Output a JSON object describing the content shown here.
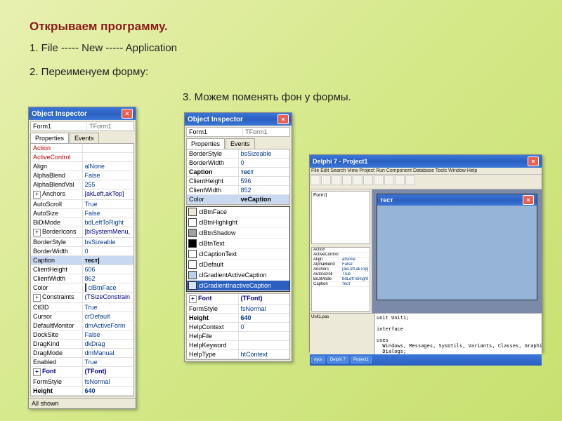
{
  "heading": "Открываем программу.",
  "steps": {
    "s1": "1.   File -----  New -----  Application",
    "s2": "2.   Переименуем форму:",
    "s3": "3.  Можем поменять фон у формы."
  },
  "inspector": {
    "title": "Object Inspector",
    "combo_name": "Form1",
    "combo_type": "TForm1",
    "tab_props": "Properties",
    "tab_events": "Events",
    "footer": "All shown"
  },
  "panel1_rows": [
    {
      "k": "Action",
      "v": "",
      "cls": "red"
    },
    {
      "k": "ActiveControl",
      "v": "",
      "cls": "red"
    },
    {
      "k": "Align",
      "v": "alNone"
    },
    {
      "k": "AlphaBlend",
      "v": "False"
    },
    {
      "k": "AlphaBlendVal",
      "v": "255"
    },
    {
      "k": "Anchors",
      "v": "[akLeft,akTop]",
      "exp": "+",
      "vcls": "navy"
    },
    {
      "k": "AutoScroll",
      "v": "True"
    },
    {
      "k": "AutoSize",
      "v": "False"
    },
    {
      "k": "BiDiMode",
      "v": "bdLeftToRight"
    },
    {
      "k": "BorderIcons",
      "v": "[biSystemMenu,",
      "exp": "+",
      "vcls": "navy"
    },
    {
      "k": "BorderStyle",
      "v": "bsSizeable"
    },
    {
      "k": "BorderWidth",
      "v": "0"
    },
    {
      "k": "Caption",
      "v": "тест|",
      "sel": true
    },
    {
      "k": "ClientHeight",
      "v": "606"
    },
    {
      "k": "ClientWidth",
      "v": "862"
    },
    {
      "k": "Color",
      "v": "clBtnFace",
      "swatch": "#ece9d8"
    },
    {
      "k": "Constraints",
      "v": "(TSizeConstrain",
      "exp": "+",
      "vcls": "navy"
    },
    {
      "k": "Ctl3D",
      "v": "True"
    },
    {
      "k": "Cursor",
      "v": "crDefault"
    },
    {
      "k": "DefaultMonitor",
      "v": "dmActiveForm"
    },
    {
      "k": "DockSite",
      "v": "False"
    },
    {
      "k": "DragKind",
      "v": "dkDrag"
    },
    {
      "k": "DragMode",
      "v": "dmManual"
    },
    {
      "k": "Enabled",
      "v": "True"
    },
    {
      "k": "Font",
      "v": "(TFont)",
      "exp": "+",
      "kcls": "bold navy",
      "vcls": "bold navy"
    },
    {
      "k": "FormStyle",
      "v": "fsNormal"
    },
    {
      "k": "Height",
      "v": "640",
      "kcls": "bold",
      "vcls": "bold"
    }
  ],
  "panel2_rows": [
    {
      "k": "BorderStyle",
      "v": "bsSizeable"
    },
    {
      "k": "BorderWidth",
      "v": "0"
    },
    {
      "k": "Caption",
      "v": "тест",
      "kcls": "bold",
      "vcls": "bold"
    },
    {
      "k": "ClientHeight",
      "v": "596"
    },
    {
      "k": "ClientWidth",
      "v": "852"
    },
    {
      "k": "Color",
      "v": "veCaption",
      "sel": true
    }
  ],
  "colors": [
    {
      "name": "clBtnFace",
      "hex": "#ece9d8"
    },
    {
      "name": "clBtnHighlight",
      "hex": "#ffffff"
    },
    {
      "name": "clBtnShadow",
      "hex": "#a0a0a0"
    },
    {
      "name": "clBtnText",
      "hex": "#000000"
    },
    {
      "name": "clCaptionText",
      "hex": "#ffffff"
    },
    {
      "name": "clDefault",
      "hex": "#ffffff"
    },
    {
      "name": "clGradientActiveCaption",
      "hex": "#b9d1ea"
    },
    {
      "name": "clGradientInactiveCaption",
      "hex": "#d7e4f2",
      "hl": true
    }
  ],
  "panel2_rows_b": [
    {
      "k": "Font",
      "v": "(TFont)",
      "exp": "+",
      "kcls": "bold navy",
      "vcls": "bold navy"
    },
    {
      "k": "FormStyle",
      "v": "fsNormal"
    },
    {
      "k": "Height",
      "v": "640",
      "kcls": "bold",
      "vcls": "bold"
    },
    {
      "k": "HelpContext",
      "v": "0"
    },
    {
      "k": "HelpFile",
      "v": ""
    },
    {
      "k": "HelpKeyword",
      "v": ""
    },
    {
      "k": "HelpType",
      "v": "htContext"
    }
  ],
  "ide": {
    "title": "Delphi 7 - Project1",
    "menu": "File  Edit  Search  View  Project  Run  Component  Database  Tools  Window  Help",
    "form_title": "тест",
    "tree": "Form1",
    "code_title": "Unit1.pas",
    "code": "unit Unit1;\n\ninterface\n\nuses\n  Windows, Messages, SysUtils, Variants, Classes, Graphics, Controls, Forms,\n  Dialogs;",
    "props": [
      {
        "k": "Action",
        "v": ""
      },
      {
        "k": "ActiveControl",
        "v": ""
      },
      {
        "k": "Align",
        "v": "alNone"
      },
      {
        "k": "AlphaBlend",
        "v": "False"
      },
      {
        "k": "Anchors",
        "v": "[akLeft,akTop]"
      },
      {
        "k": "AutoScroll",
        "v": "True"
      },
      {
        "k": "BiDiMode",
        "v": "bdLeftToRight"
      },
      {
        "k": "Caption",
        "v": "тест"
      }
    ],
    "task": [
      "пуск",
      "Delphi 7",
      "Project1"
    ]
  }
}
